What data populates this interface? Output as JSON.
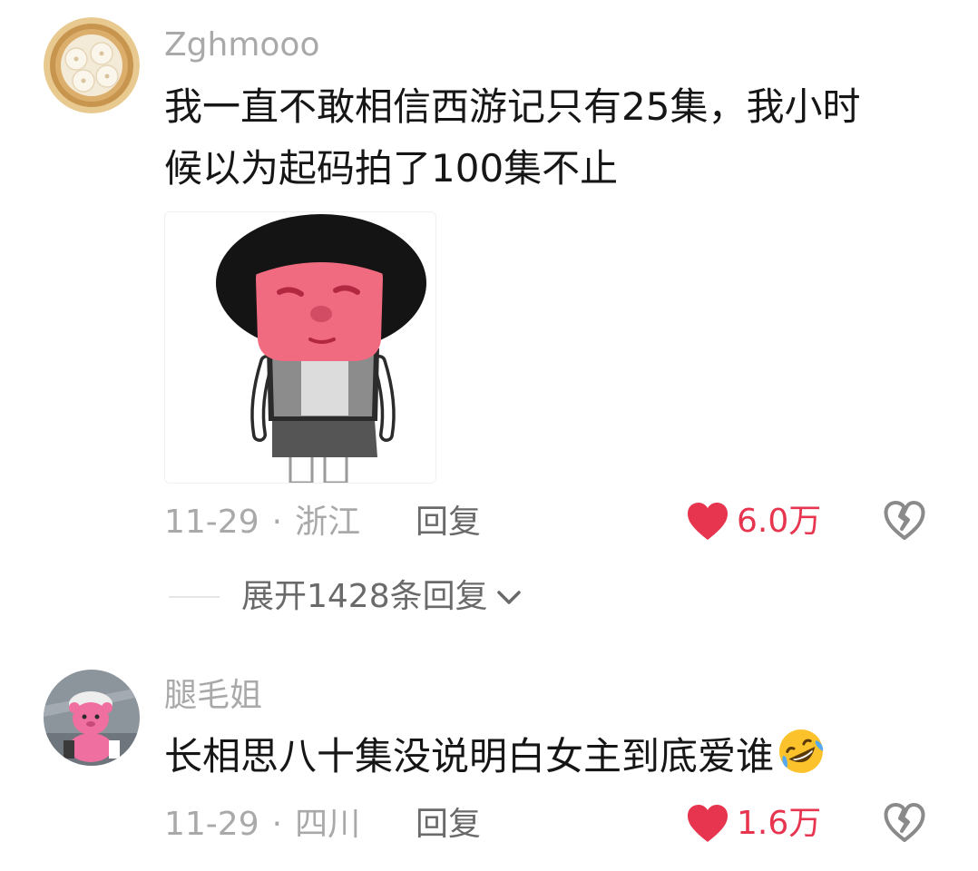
{
  "comments": [
    {
      "avatar_icon": "dumpling-steamer-avatar",
      "username": "Zghmooo",
      "text_line1": "我一直不敢相信西游记只有25集，我小时",
      "text_line2": "候以为起码拍了100集不止",
      "sticker_icon": "cartoon-boy-sticker",
      "date": "11-29",
      "location": "浙江",
      "reply_label": "回复",
      "likes": "6.0万",
      "expand_replies": "展开1428条回复"
    },
    {
      "avatar_icon": "pink-bear-avatar",
      "username": "腿毛姐",
      "text": "长相思八十集没说明白女主到底爱谁",
      "emoji_icon": "rolling-laughing-emoji",
      "date": "11-29",
      "location": "四川",
      "reply_label": "回复",
      "likes": "1.6万"
    }
  ],
  "separator": "·",
  "colors": {
    "like_red": "#e7344f",
    "muted_gray": "#a9a9a9",
    "text_dark": "#161616"
  }
}
